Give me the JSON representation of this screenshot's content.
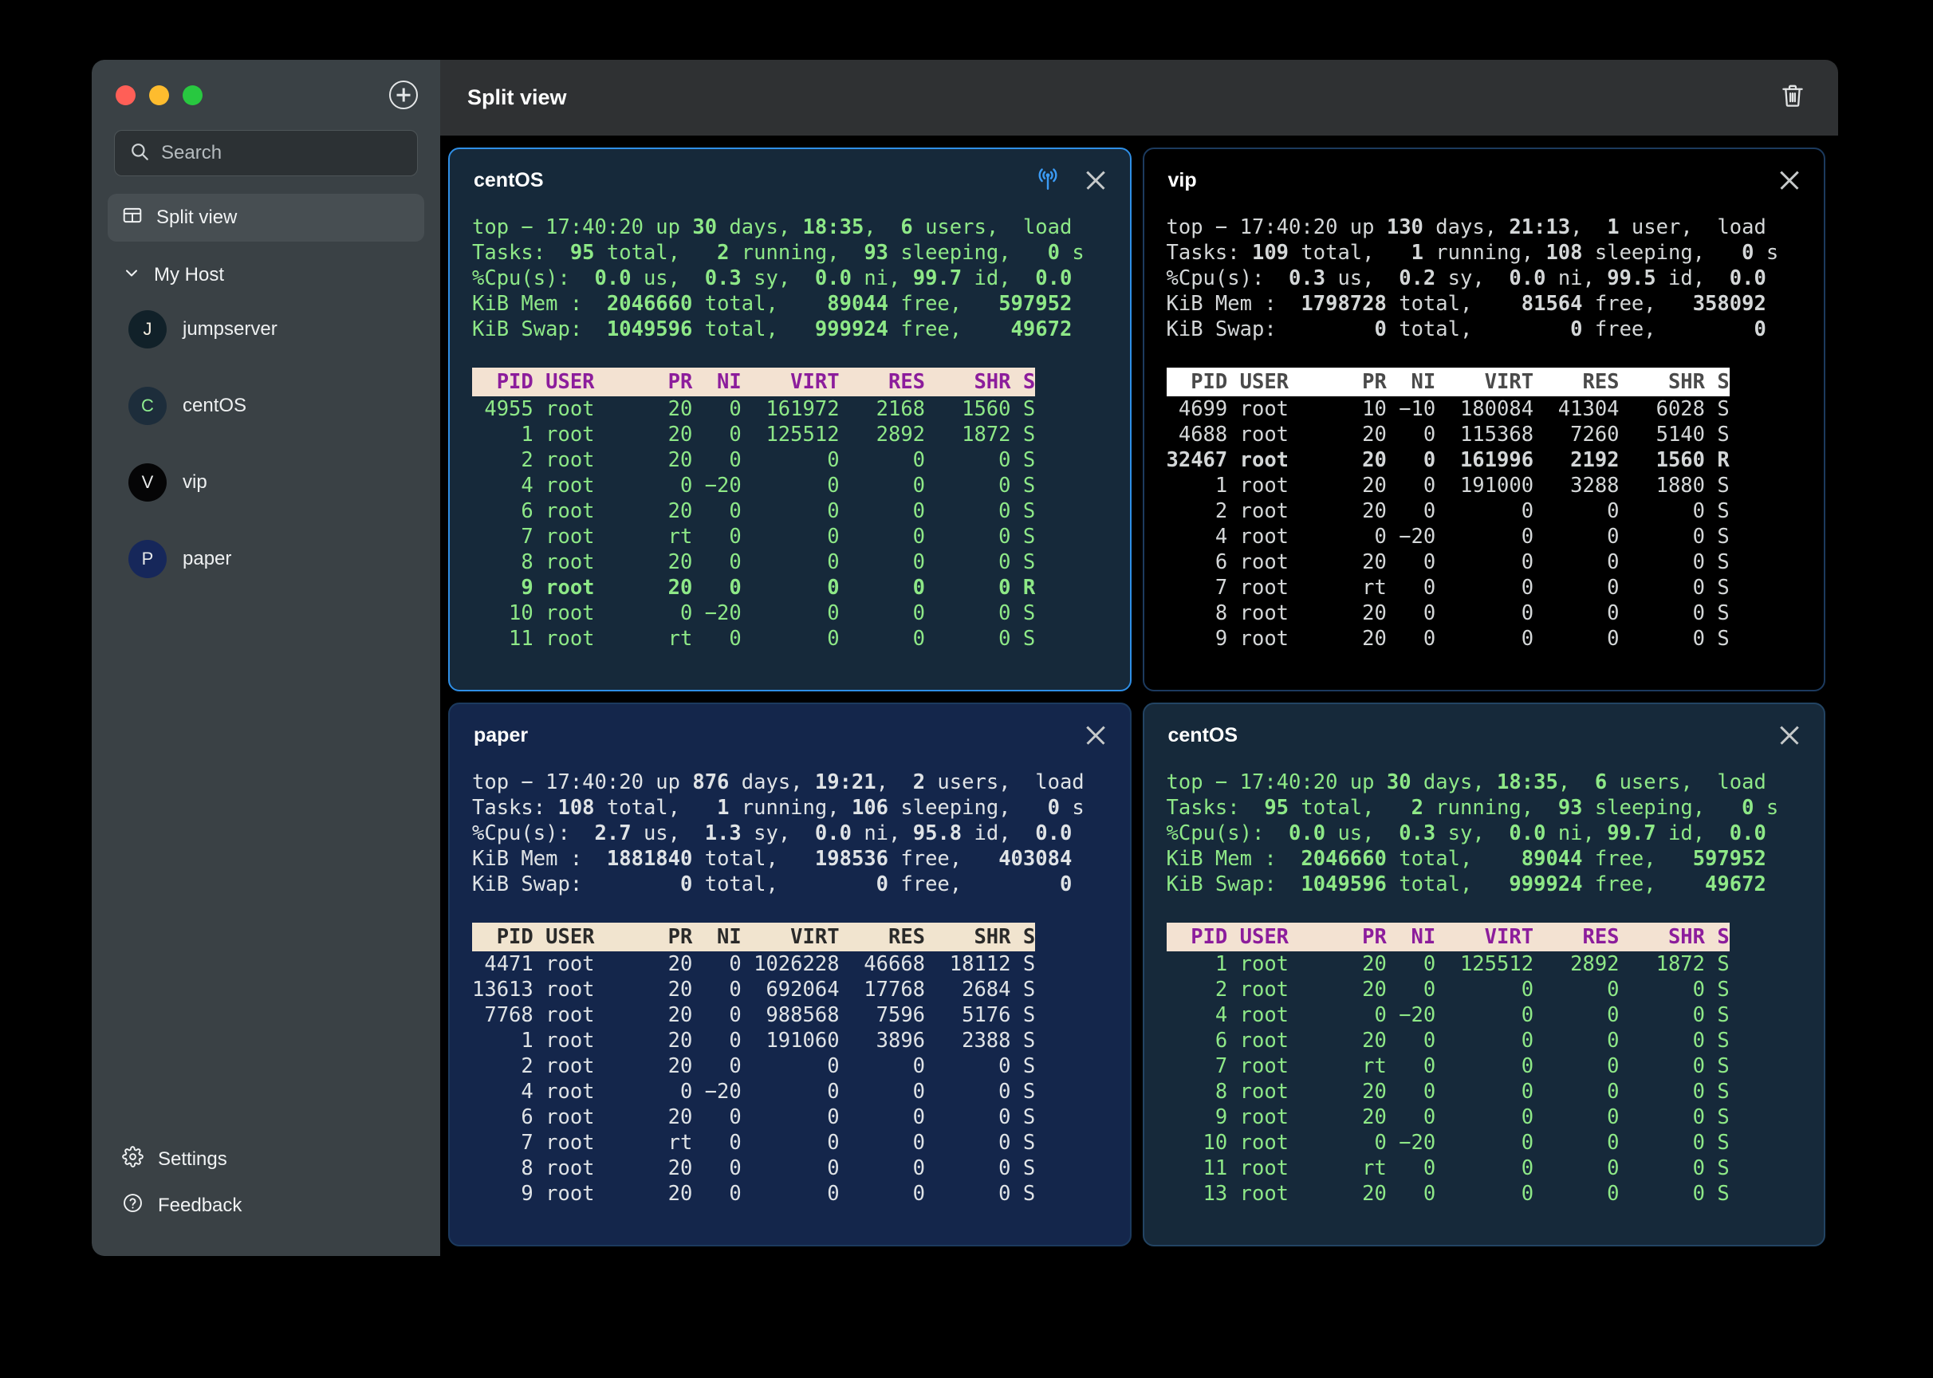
{
  "window": {
    "traffic_lights": [
      "close",
      "minimize",
      "maximize"
    ],
    "add_button": "add-icon"
  },
  "sidebar": {
    "search": {
      "placeholder": "Search",
      "value": ""
    },
    "nav": [
      {
        "label": "Split view",
        "icon": "split-view-icon",
        "active": true
      }
    ],
    "group": {
      "label": "My Host",
      "expanded": true,
      "chevron": "chevron-down-icon"
    },
    "hosts": [
      {
        "initial": "J",
        "label": "jumpserver",
        "avatar_bg": "#112129",
        "initial_color": "#f6eedf"
      },
      {
        "initial": "C",
        "label": "centOS",
        "avatar_bg": "#1d2d3b",
        "initial_color": "#90ee90"
      },
      {
        "initial": "V",
        "label": "vip",
        "avatar_bg": "#050506",
        "initial_color": "#e8eaea"
      },
      {
        "initial": "P",
        "label": "paper",
        "avatar_bg": "#16275a",
        "initial_color": "#e8eaea"
      }
    ],
    "bottom": [
      {
        "label": "Settings",
        "icon": "gear-icon"
      },
      {
        "label": "Feedback",
        "icon": "help-circle-icon"
      }
    ]
  },
  "header": {
    "title": "Split view",
    "trash_icon": "trash-icon"
  },
  "panes": [
    {
      "title": "centOS",
      "active": true,
      "border": "#2f8fe6",
      "bg": "#16293a",
      "fg": "#8ee887",
      "hdr_bg": "#f3e2d2",
      "hdr_fg": "#8c1d9c",
      "broadcast_icon": "broadcast-icon",
      "close_icon": "close-icon",
      "lines": [
        [
          {
            "t": "top − 17:40:20 up ",
            "b": false
          },
          {
            "t": "30",
            "b": true
          },
          {
            "t": " days, ",
            "b": false
          },
          {
            "t": "18:35",
            "b": true
          },
          {
            "t": ",  ",
            "b": false
          },
          {
            "t": "6",
            "b": true
          },
          {
            "t": " users,  load",
            "b": false
          }
        ],
        [
          {
            "t": "Tasks:  ",
            "b": false
          },
          {
            "t": "95",
            "b": true
          },
          {
            "t": " total,   ",
            "b": false
          },
          {
            "t": "2",
            "b": true
          },
          {
            "t": " running,  ",
            "b": false
          },
          {
            "t": "93",
            "b": true
          },
          {
            "t": " sleeping,   ",
            "b": false
          },
          {
            "t": "0",
            "b": true
          },
          {
            "t": " s",
            "b": false
          }
        ],
        [
          {
            "t": "%Cpu(s):  ",
            "b": false
          },
          {
            "t": "0.0",
            "b": true
          },
          {
            "t": " us,  ",
            "b": false
          },
          {
            "t": "0.3",
            "b": true
          },
          {
            "t": " sy,  ",
            "b": false
          },
          {
            "t": "0.0",
            "b": true
          },
          {
            "t": " ni, ",
            "b": false
          },
          {
            "t": "99.7",
            "b": true
          },
          {
            "t": " id,  ",
            "b": false
          },
          {
            "t": "0.0",
            "b": true
          }
        ],
        [
          {
            "t": "KiB Mem :  ",
            "b": false
          },
          {
            "t": "2046660",
            "b": true
          },
          {
            "t": " total,    ",
            "b": false
          },
          {
            "t": "89044",
            "b": true
          },
          {
            "t": " free,   ",
            "b": false
          },
          {
            "t": "597952",
            "b": true
          }
        ],
        [
          {
            "t": "KiB Swap:  ",
            "b": false
          },
          {
            "t": "1049596",
            "b": true
          },
          {
            "t": " total,   ",
            "b": false
          },
          {
            "t": "999924",
            "b": true
          },
          {
            "t": " free,    ",
            "b": false
          },
          {
            "t": "49672",
            "b": true
          }
        ]
      ],
      "columns_header": "  PID USER      PR  NI    VIRT    RES    SHR S",
      "rows": [
        {
          "text": " 4955 root      20   0  161972   2168   1560 S",
          "b": false
        },
        {
          "text": "    1 root      20   0  125512   2892   1872 S",
          "b": false
        },
        {
          "text": "    2 root      20   0       0      0      0 S",
          "b": false
        },
        {
          "text": "    4 root       0 −20       0      0      0 S",
          "b": false
        },
        {
          "text": "    6 root      20   0       0      0      0 S",
          "b": false
        },
        {
          "text": "    7 root      rt   0       0      0      0 S",
          "b": false
        },
        {
          "text": "    8 root      20   0       0      0      0 S",
          "b": false
        },
        {
          "text": "    9 root      20   0       0      0      0 R",
          "b": true
        },
        {
          "text": "   10 root       0 −20       0      0      0 S",
          "b": false
        },
        {
          "text": "   11 root      rt   0       0      0      0 S",
          "b": false
        }
      ]
    },
    {
      "title": "vip",
      "active": false,
      "border": "#1c3a5e",
      "bg": "#000000",
      "fg": "#d4d7d8",
      "hdr_bg": "#ffffff",
      "hdr_fg": "#4a4a4a",
      "broadcast_icon": null,
      "close_icon": "close-icon",
      "lines": [
        [
          {
            "t": "top − 17:40:20 up ",
            "b": false
          },
          {
            "t": "130",
            "b": true
          },
          {
            "t": " days, ",
            "b": false
          },
          {
            "t": "21:13",
            "b": true
          },
          {
            "t": ",  ",
            "b": false
          },
          {
            "t": "1",
            "b": true
          },
          {
            "t": " user,  load",
            "b": false
          }
        ],
        [
          {
            "t": "Tasks: ",
            "b": false
          },
          {
            "t": "109",
            "b": true
          },
          {
            "t": " total,   ",
            "b": false
          },
          {
            "t": "1",
            "b": true
          },
          {
            "t": " running, ",
            "b": false
          },
          {
            "t": "108",
            "b": true
          },
          {
            "t": " sleeping,   ",
            "b": false
          },
          {
            "t": "0",
            "b": true
          },
          {
            "t": " s",
            "b": false
          }
        ],
        [
          {
            "t": "%Cpu(s):  ",
            "b": false
          },
          {
            "t": "0.3",
            "b": true
          },
          {
            "t": " us,  ",
            "b": false
          },
          {
            "t": "0.2",
            "b": true
          },
          {
            "t": " sy,  ",
            "b": false
          },
          {
            "t": "0.0",
            "b": true
          },
          {
            "t": " ni, ",
            "b": false
          },
          {
            "t": "99.5",
            "b": true
          },
          {
            "t": " id,  ",
            "b": false
          },
          {
            "t": "0.0",
            "b": true
          }
        ],
        [
          {
            "t": "KiB Mem :  ",
            "b": false
          },
          {
            "t": "1798728",
            "b": true
          },
          {
            "t": " total,    ",
            "b": false
          },
          {
            "t": "81564",
            "b": true
          },
          {
            "t": " free,   ",
            "b": false
          },
          {
            "t": "358092",
            "b": true
          }
        ],
        [
          {
            "t": "KiB Swap:        ",
            "b": false
          },
          {
            "t": "0",
            "b": true
          },
          {
            "t": " total,        ",
            "b": false
          },
          {
            "t": "0",
            "b": true
          },
          {
            "t": " free,        ",
            "b": false
          },
          {
            "t": "0",
            "b": true
          }
        ]
      ],
      "columns_header": "  PID USER      PR  NI    VIRT    RES    SHR S",
      "rows": [
        {
          "text": " 4699 root      10 −10  180084  41304   6028 S",
          "b": false
        },
        {
          "text": " 4688 root      20   0  115368   7260   5140 S",
          "b": false
        },
        {
          "text": "32467 root      20   0  161996   2192   1560 R",
          "b": true
        },
        {
          "text": "    1 root      20   0  191000   3288   1880 S",
          "b": false
        },
        {
          "text": "    2 root      20   0       0      0      0 S",
          "b": false
        },
        {
          "text": "    4 root       0 −20       0      0      0 S",
          "b": false
        },
        {
          "text": "    6 root      20   0       0      0      0 S",
          "b": false
        },
        {
          "text": "    7 root      rt   0       0      0      0 S",
          "b": false
        },
        {
          "text": "    8 root      20   0       0      0      0 S",
          "b": false
        },
        {
          "text": "    9 root      20   0       0      0      0 S",
          "b": false
        }
      ]
    },
    {
      "title": "paper",
      "active": false,
      "border": "#1c3a5e",
      "bg": "#14264b",
      "fg": "#dfe3e6",
      "hdr_bg": "#f1e4cf",
      "hdr_fg": "#2a2a2a",
      "broadcast_icon": null,
      "close_icon": "close-icon",
      "lines": [
        [
          {
            "t": "top − 17:40:20 up ",
            "b": false
          },
          {
            "t": "876",
            "b": true
          },
          {
            "t": " days, ",
            "b": false
          },
          {
            "t": "19:21",
            "b": true
          },
          {
            "t": ",  ",
            "b": false
          },
          {
            "t": "2",
            "b": true
          },
          {
            "t": " users,  load",
            "b": false
          }
        ],
        [
          {
            "t": "Tasks: ",
            "b": false
          },
          {
            "t": "108",
            "b": true
          },
          {
            "t": " total,   ",
            "b": false
          },
          {
            "t": "1",
            "b": true
          },
          {
            "t": " running, ",
            "b": false
          },
          {
            "t": "106",
            "b": true
          },
          {
            "t": " sleeping,   ",
            "b": false
          },
          {
            "t": "0",
            "b": true
          },
          {
            "t": " s",
            "b": false
          }
        ],
        [
          {
            "t": "%Cpu(s):  ",
            "b": false
          },
          {
            "t": "2.7",
            "b": true
          },
          {
            "t": " us,  ",
            "b": false
          },
          {
            "t": "1.3",
            "b": true
          },
          {
            "t": " sy,  ",
            "b": false
          },
          {
            "t": "0.0",
            "b": true
          },
          {
            "t": " ni, ",
            "b": false
          },
          {
            "t": "95.8",
            "b": true
          },
          {
            "t": " id,  ",
            "b": false
          },
          {
            "t": "0.0",
            "b": true
          }
        ],
        [
          {
            "t": "KiB Mem :  ",
            "b": false
          },
          {
            "t": "1881840",
            "b": true
          },
          {
            "t": " total,   ",
            "b": false
          },
          {
            "t": "198536",
            "b": true
          },
          {
            "t": " free,   ",
            "b": false
          },
          {
            "t": "403084",
            "b": true
          }
        ],
        [
          {
            "t": "KiB Swap:        ",
            "b": false
          },
          {
            "t": "0",
            "b": true
          },
          {
            "t": " total,        ",
            "b": false
          },
          {
            "t": "0",
            "b": true
          },
          {
            "t": " free,        ",
            "b": false
          },
          {
            "t": "0",
            "b": true
          }
        ]
      ],
      "columns_header": "  PID USER      PR  NI    VIRT    RES    SHR S",
      "rows": [
        {
          "text": " 4471 root      20   0 1026228  46668  18112 S",
          "b": false
        },
        {
          "text": "13613 root      20   0  692064  17768   2684 S",
          "b": false
        },
        {
          "text": " 7768 root      20   0  988568   7596   5176 S",
          "b": false
        },
        {
          "text": "    1 root      20   0  191060   3896   2388 S",
          "b": false
        },
        {
          "text": "    2 root      20   0       0      0      0 S",
          "b": false
        },
        {
          "text": "    4 root       0 −20       0      0      0 S",
          "b": false
        },
        {
          "text": "    6 root      20   0       0      0      0 S",
          "b": false
        },
        {
          "text": "    7 root      rt   0       0      0      0 S",
          "b": false
        },
        {
          "text": "    8 root      20   0       0      0      0 S",
          "b": false
        },
        {
          "text": "    9 root      20   0       0      0      0 S",
          "b": false
        }
      ]
    },
    {
      "title": "centOS",
      "active": false,
      "border": "#234463",
      "bg": "#16293a",
      "fg": "#8ee887",
      "hdr_bg": "#f3e2d2",
      "hdr_fg": "#8c1d9c",
      "broadcast_icon": null,
      "close_icon": "close-icon",
      "lines": [
        [
          {
            "t": "top − 17:40:20 up ",
            "b": false
          },
          {
            "t": "30",
            "b": true
          },
          {
            "t": " days, ",
            "b": false
          },
          {
            "t": "18:35",
            "b": true
          },
          {
            "t": ",  ",
            "b": false
          },
          {
            "t": "6",
            "b": true
          },
          {
            "t": " users,  load",
            "b": false
          }
        ],
        [
          {
            "t": "Tasks:  ",
            "b": false
          },
          {
            "t": "95",
            "b": true
          },
          {
            "t": " total,   ",
            "b": false
          },
          {
            "t": "2",
            "b": true
          },
          {
            "t": " running,  ",
            "b": false
          },
          {
            "t": "93",
            "b": true
          },
          {
            "t": " sleeping,   ",
            "b": false
          },
          {
            "t": "0",
            "b": true
          },
          {
            "t": " s",
            "b": false
          }
        ],
        [
          {
            "t": "%Cpu(s):  ",
            "b": false
          },
          {
            "t": "0.0",
            "b": true
          },
          {
            "t": " us,  ",
            "b": false
          },
          {
            "t": "0.3",
            "b": true
          },
          {
            "t": " sy,  ",
            "b": false
          },
          {
            "t": "0.0",
            "b": true
          },
          {
            "t": " ni, ",
            "b": false
          },
          {
            "t": "99.7",
            "b": true
          },
          {
            "t": " id,  ",
            "b": false
          },
          {
            "t": "0.0",
            "b": true
          }
        ],
        [
          {
            "t": "KiB Mem :  ",
            "b": false
          },
          {
            "t": "2046660",
            "b": true
          },
          {
            "t": " total,    ",
            "b": false
          },
          {
            "t": "89044",
            "b": true
          },
          {
            "t": " free,   ",
            "b": false
          },
          {
            "t": "597952",
            "b": true
          }
        ],
        [
          {
            "t": "KiB Swap:  ",
            "b": false
          },
          {
            "t": "1049596",
            "b": true
          },
          {
            "t": " total,   ",
            "b": false
          },
          {
            "t": "999924",
            "b": true
          },
          {
            "t": " free,    ",
            "b": false
          },
          {
            "t": "49672",
            "b": true
          }
        ]
      ],
      "columns_header": "  PID USER      PR  NI    VIRT    RES    SHR S",
      "rows": [
        {
          "text": "    1 root      20   0  125512   2892   1872 S",
          "b": false
        },
        {
          "text": "    2 root      20   0       0      0      0 S",
          "b": false
        },
        {
          "text": "    4 root       0 −20       0      0      0 S",
          "b": false
        },
        {
          "text": "    6 root      20   0       0      0      0 S",
          "b": false
        },
        {
          "text": "    7 root      rt   0       0      0      0 S",
          "b": false
        },
        {
          "text": "    8 root      20   0       0      0      0 S",
          "b": false
        },
        {
          "text": "    9 root      20   0       0      0      0 S",
          "b": false
        },
        {
          "text": "   10 root       0 −20       0      0      0 S",
          "b": false
        },
        {
          "text": "   11 root      rt   0       0      0      0 S",
          "b": false
        },
        {
          "text": "   13 root      20   0       0      0      0 S",
          "b": false
        }
      ]
    }
  ]
}
